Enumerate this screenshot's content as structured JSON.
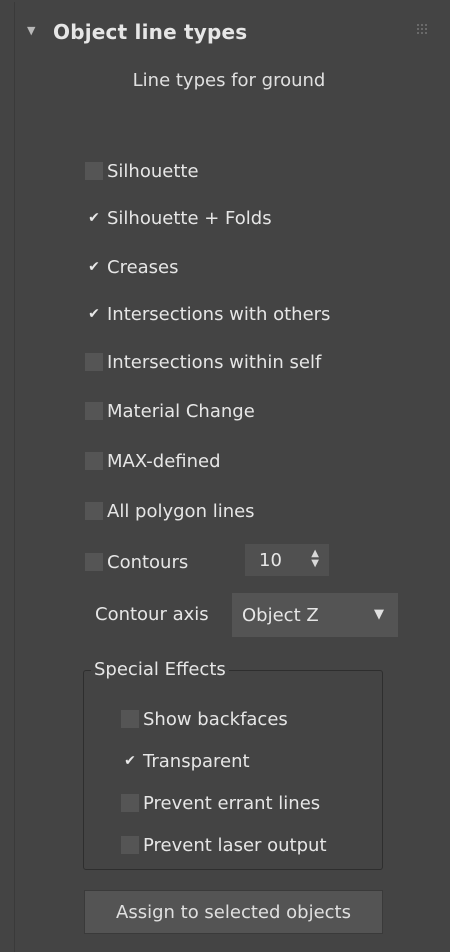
{
  "rollout": {
    "title": "Object line types",
    "arrow": "▼",
    "subtitle": "Line types for ground"
  },
  "checkboxes": {
    "silhouette": {
      "label": "Silhouette",
      "checked": false
    },
    "silhouette_folds": {
      "label": "Silhouette + Folds",
      "checked": true
    },
    "creases": {
      "label": "Creases",
      "checked": true
    },
    "intersections_others": {
      "label": "Intersections with others",
      "checked": true
    },
    "intersections_self": {
      "label": "Intersections within self",
      "checked": false
    },
    "material_change": {
      "label": "Material Change",
      "checked": false
    },
    "max_defined": {
      "label": "MAX-defined",
      "checked": false
    },
    "all_polygon_lines": {
      "label": "All polygon lines",
      "checked": false
    },
    "contours": {
      "label": "Contours",
      "checked": false
    }
  },
  "contours_spinner": {
    "value": "10",
    "up": "▲",
    "down": "▼"
  },
  "contour_axis": {
    "label": "Contour axis",
    "value": "Object Z",
    "arrow": "▼"
  },
  "special_effects": {
    "title": "Special Effects",
    "show_backfaces": {
      "label": "Show backfaces",
      "checked": false
    },
    "transparent": {
      "label": "Transparent",
      "checked": true
    },
    "prevent_errant_lines": {
      "label": "Prevent errant lines",
      "checked": false
    },
    "prevent_laser_output": {
      "label": "Prevent laser output",
      "checked": false
    }
  },
  "assign_button": {
    "label": "Assign to selected objects"
  },
  "check_glyph": "✔",
  "colors": {
    "panel_bg": "#444444",
    "control_bg": "#545454",
    "text": "#e6e6e6",
    "border_dark": "#2e2e2e"
  }
}
